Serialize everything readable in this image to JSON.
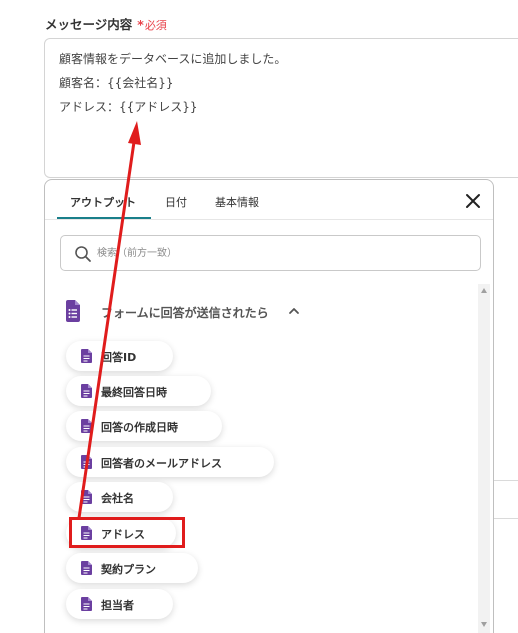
{
  "field": {
    "label": "メッセージ内容",
    "asterisk": "*",
    "required": "必須"
  },
  "message": {
    "lines": [
      "顧客情報をデータベースに追加しました。",
      "顧客名：{{会社名}}",
      "アドレス：{{アドレス}}"
    ]
  },
  "panel": {
    "tabs": [
      {
        "label": "アウトプット",
        "active": true
      },
      {
        "label": "日付",
        "active": false
      },
      {
        "label": "基本情報",
        "active": false
      }
    ],
    "search": {
      "placeholder": "検索（前方一致）",
      "value": ""
    },
    "section": {
      "title": "フォームに回答が送信されたら",
      "expanded": true
    },
    "items": [
      {
        "label": "回答ID"
      },
      {
        "label": "最終回答日時"
      },
      {
        "label": "回答の作成日時"
      },
      {
        "label": "回答者のメールアドレス"
      },
      {
        "label": "会社名"
      },
      {
        "label": "アドレス",
        "highlighted": true
      },
      {
        "label": "契約プラン"
      },
      {
        "label": "担当者"
      }
    ]
  },
  "colors": {
    "accent": "#1a7f8a",
    "required": "#e8424a",
    "annotation": "#e01c1c",
    "form_icon": "#6b3fa0"
  }
}
